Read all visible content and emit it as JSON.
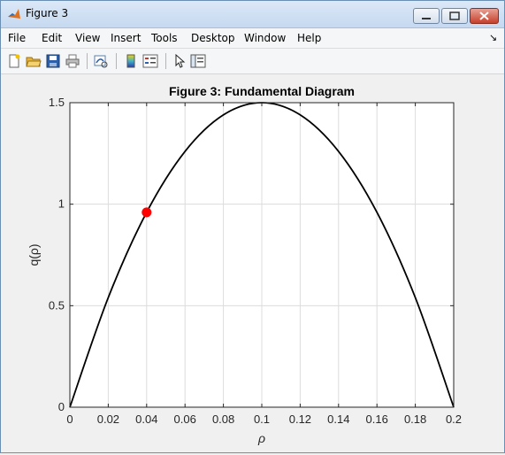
{
  "window": {
    "title": "Figure 3",
    "icon": "matlab-icon"
  },
  "menu": [
    "File",
    "Edit",
    "View",
    "Insert",
    "Tools",
    "Desktop",
    "Window",
    "Help"
  ],
  "toolbar_icons": [
    "new-figure-icon",
    "open-file-icon",
    "save-icon",
    "print-icon",
    "link-plot-icon",
    "insert-colorbar-icon",
    "insert-legend-icon",
    "pointer-icon",
    "plot-tools-icon"
  ],
  "chart_data": {
    "type": "line",
    "title": "Figure 3: Fundamental Diagram",
    "xlabel": "ρ",
    "ylabel": "q(ρ)",
    "xlim": [
      0,
      0.2
    ],
    "ylim": [
      0,
      1.5
    ],
    "xticks": [
      "0",
      "0.02",
      "0.04",
      "0.06",
      "0.08",
      "0.1",
      "0.12",
      "0.14",
      "0.16",
      "0.18",
      "0.2"
    ],
    "yticks": [
      "0",
      "0.5",
      "1",
      "1.5"
    ],
    "grid": true,
    "series": [
      {
        "color": "#000000",
        "x": [
          0,
          0.02,
          0.04,
          0.06,
          0.08,
          0.1,
          0.12,
          0.14,
          0.16,
          0.18,
          0.2
        ],
        "y": [
          0,
          0.54,
          0.96,
          1.26,
          1.44,
          1.5,
          1.44,
          1.26,
          0.96,
          0.54,
          0
        ]
      }
    ],
    "markers": [
      {
        "x": 0.04,
        "y": 0.96,
        "color": "#ff0000"
      }
    ]
  }
}
